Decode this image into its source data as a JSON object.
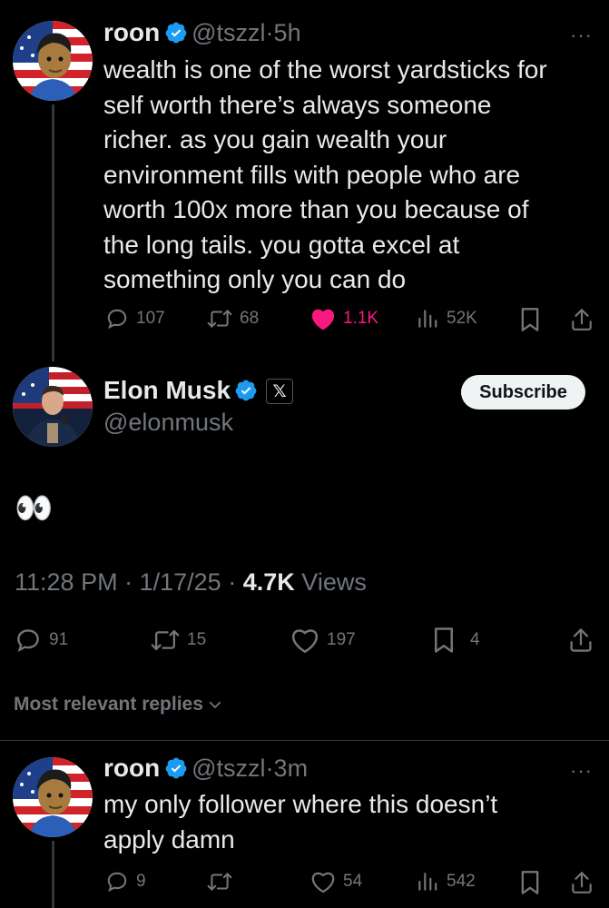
{
  "parent_tweet": {
    "name": "roon",
    "handle": "@tszzl",
    "time": "5h",
    "text_lines": [
      "wealth is one of the worst yardsticks for",
      "self worth there’s always someone",
      "richer. as you gain wealth your",
      "environment fills with people who are",
      "worth 100x more than you because of",
      "the long tails. you gotta excel at",
      "something only you can do"
    ],
    "replies": "107",
    "retweets": "68",
    "likes": "1.1K",
    "views": "52K",
    "more": "···"
  },
  "main_tweet": {
    "name": "Elon Musk",
    "handle": "@elonmusk",
    "badge": "𝕏",
    "subscribe_label": "Subscribe",
    "text": "👀",
    "time": "11:28 PM",
    "date": "1/17/25",
    "views_count": "4.7K",
    "views_label": "Views",
    "sep": "·",
    "replies": "91",
    "retweets": "15",
    "likes": "197",
    "bookmarks": "4"
  },
  "replies_sort": {
    "label": "Most relevant replies"
  },
  "reply_tweet": {
    "name": "roon",
    "handle": "@tszzl",
    "time": "3m",
    "text_lines": [
      "my only follower where this doesn’t",
      "apply damn"
    ],
    "replies": "9",
    "likes": "54",
    "views": "542",
    "more": "···"
  },
  "colors": {
    "background": "#000000",
    "text": "#e7e9ea",
    "muted": "#71767b",
    "verified_blue": "#1d9bf0",
    "like_pink": "#f91880"
  }
}
